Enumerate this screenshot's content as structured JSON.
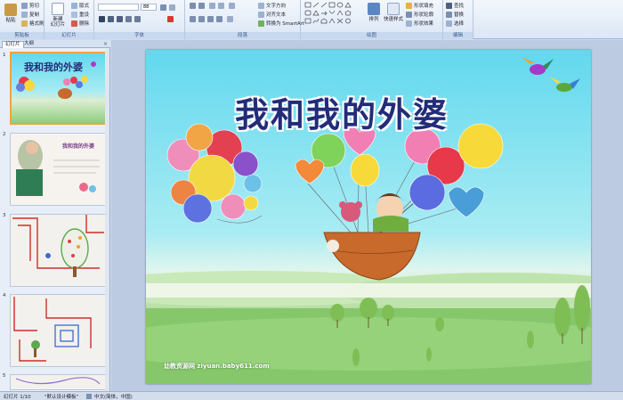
{
  "ribbon": {
    "clipboard": {
      "paste": "粘贴",
      "cut": "剪切",
      "copy": "复制",
      "format_painter": "格式刷",
      "label": "剪贴板"
    },
    "slides": {
      "new_slide": "新建\n幻灯片",
      "layout": "版式",
      "reset": "重设",
      "delete": "删除",
      "label": "幻灯片"
    },
    "font": {
      "font_name": "",
      "font_size": "88",
      "label": "字体"
    },
    "paragraph": {
      "text_direction": "文字方向",
      "align_text": "对齐文本",
      "smartart": "转换为 SmartArt",
      "label": "段落"
    },
    "drawing": {
      "arrange": "排列",
      "quick_styles": "快速样式",
      "shape_fill": "形状填充",
      "shape_outline": "形状轮廓",
      "shape_effects": "形状效果",
      "label": "绘图"
    },
    "editing": {
      "find": "查找",
      "replace": "替换",
      "select": "选择",
      "label": "编辑"
    }
  },
  "pane": {
    "tabs": [
      "幻灯片",
      "大纲"
    ],
    "close": "×",
    "thumbnails": [
      {
        "number": "1",
        "title": "我和我的外婆"
      },
      {
        "number": "2",
        "title": "我和我的外婆"
      },
      {
        "number": "3",
        "title": ""
      },
      {
        "number": "4",
        "title": ""
      },
      {
        "number": "5",
        "title": ""
      }
    ]
  },
  "slide": {
    "title": "我和我的外婆",
    "watermark": "幼教资源网 ziyuan.baby611.com"
  },
  "status": {
    "slide_counter": "幻灯片 1/10",
    "theme": "\"默认设计模板\"",
    "language": "中文(简体，中国)"
  },
  "colors": {
    "accent": "#f3a33a",
    "title": "#232c78",
    "ribbon_label": "#3a5a8a"
  }
}
